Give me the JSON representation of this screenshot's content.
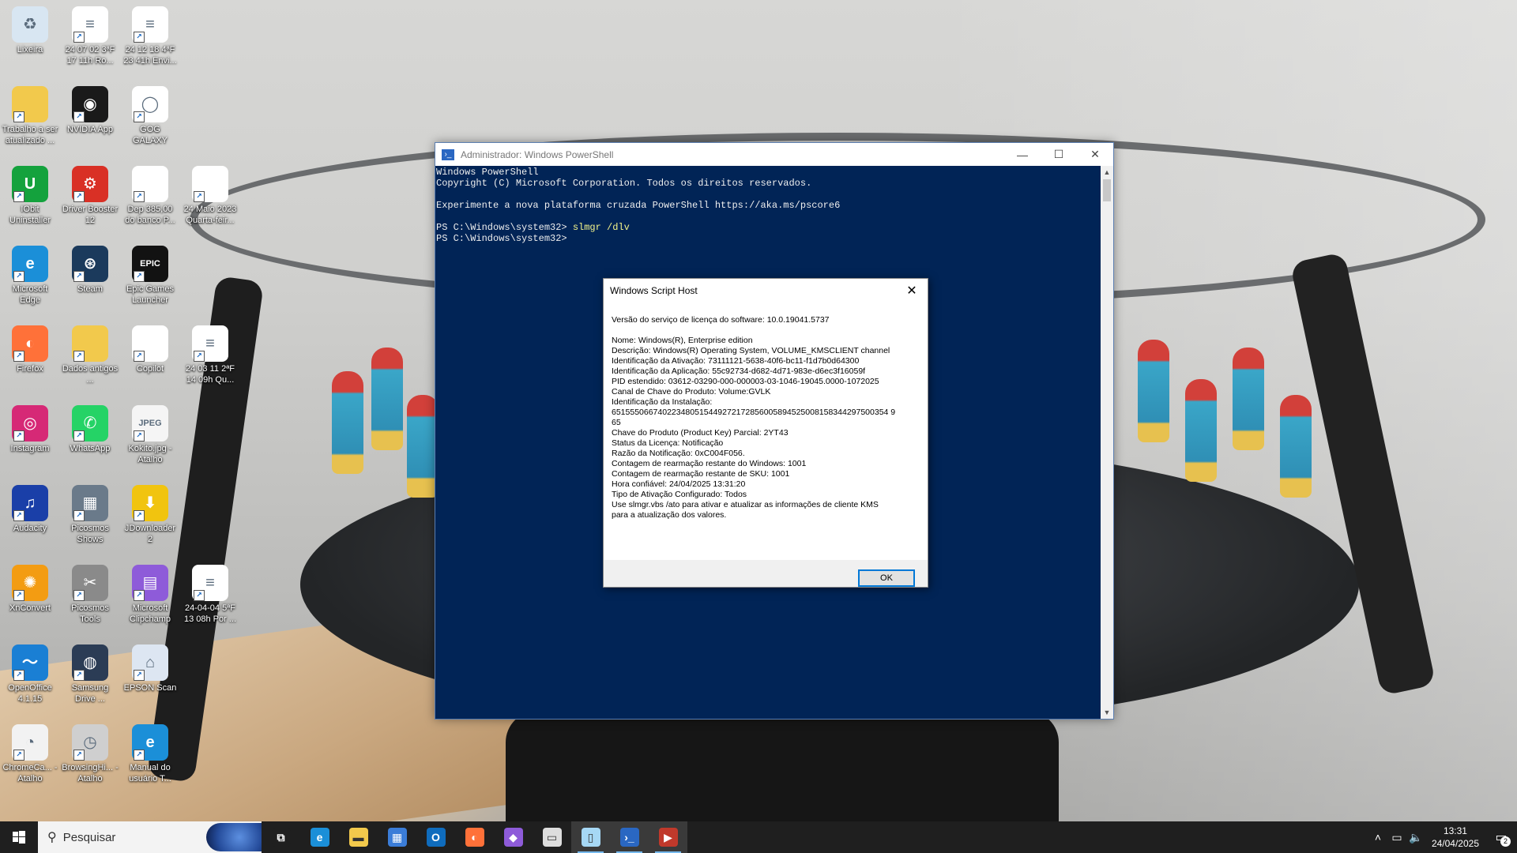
{
  "desktop": {
    "icons": [
      {
        "label": "Lixeira",
        "icon": "recycle-bin-icon",
        "color": "#d8e6f2",
        "glyph": "♻"
      },
      {
        "label": "24 07 02 3ªF 17 11h Ro...",
        "icon": "document-icon",
        "color": "#ffffff",
        "glyph": "≡"
      },
      {
        "label": "24 12 18 4ªF 23 41h Envi...",
        "icon": "document-icon",
        "color": "#ffffff",
        "glyph": "≡"
      },
      {
        "label": "Trabalho a ser atualizado ...",
        "icon": "folder-icon",
        "color": "#f2c94c",
        "glyph": ""
      },
      {
        "label": "NVIDIA App",
        "icon": "nvidia-icon",
        "color": "#1a1a1a",
        "glyph": "◉"
      },
      {
        "label": "GOG GALAXY",
        "icon": "gog-galaxy-icon",
        "color": "#ffffff",
        "glyph": "◯"
      },
      {
        "label": "IObit Uninstaller",
        "icon": "iobit-uninstaller-icon",
        "color": "#14a23d",
        "glyph": "U"
      },
      {
        "label": "Driver Booster 12",
        "icon": "driver-booster-icon",
        "color": "#d93025",
        "glyph": "⚙"
      },
      {
        "label": "Dep 385,00 do banco P...",
        "icon": "document-icon",
        "color": "#ffffff",
        "glyph": ""
      },
      {
        "label": "24 Maio 2023 Quarta-feir...",
        "icon": "document-icon",
        "color": "#ffffff",
        "glyph": ""
      },
      {
        "label": "Microsoft Edge",
        "icon": "edge-icon",
        "color": "#1b8fd8",
        "glyph": "e"
      },
      {
        "label": "Steam",
        "icon": "steam-icon",
        "color": "#1b3a5c",
        "glyph": "⊛"
      },
      {
        "label": "Epic Games Launcher",
        "icon": "epic-games-icon",
        "color": "#121212",
        "glyph": "EPIC"
      },
      {
        "label": "Firefox",
        "icon": "firefox-icon",
        "color": "#ff7139",
        "glyph": "◐"
      },
      {
        "label": "Dados antigos ...",
        "icon": "folder-icon",
        "color": "#f2c94c",
        "glyph": ""
      },
      {
        "label": "Copilot",
        "icon": "document-icon",
        "color": "#ffffff",
        "glyph": ""
      },
      {
        "label": "24 03 11 2ªF 14 09h Qu...",
        "icon": "document-icon",
        "color": "#ffffff",
        "glyph": "≡"
      },
      {
        "label": "Instagram",
        "icon": "instagram-icon",
        "color": "#d62976",
        "glyph": "◎"
      },
      {
        "label": "WhatsApp",
        "icon": "whatsapp-icon",
        "color": "#25d366",
        "glyph": "✆"
      },
      {
        "label": "Kokito.jpg - Atalho",
        "icon": "image-file-icon",
        "color": "#f5f5f5",
        "glyph": "JPEG"
      },
      {
        "label": "Audacity",
        "icon": "audacity-icon",
        "color": "#1a3fa8",
        "glyph": "♫"
      },
      {
        "label": "Picosmos Shows",
        "icon": "picosmos-shows-icon",
        "color": "#6a7a8a",
        "glyph": "▦"
      },
      {
        "label": "JDownloader 2",
        "icon": "jdownloader-icon",
        "color": "#f1c40f",
        "glyph": "⬇"
      },
      {
        "label": "XnConvert",
        "icon": "xnconvert-icon",
        "color": "#f39c12",
        "glyph": "✺"
      },
      {
        "label": "Picosmos Tools",
        "icon": "picosmos-tools-icon",
        "color": "#8a8a8a",
        "glyph": "✂"
      },
      {
        "label": "Microsoft Clipchamp",
        "icon": "clipchamp-icon",
        "color": "#8e5bd9",
        "glyph": "▤"
      },
      {
        "label": "24-04-04 5ªF 13 08h Por ...",
        "icon": "document-icon",
        "color": "#ffffff",
        "glyph": "≡"
      },
      {
        "label": "OpenOffice 4.1.15",
        "icon": "openoffice-icon",
        "color": "#1a7fd4",
        "glyph": "〜"
      },
      {
        "label": "Samsung Drive ...",
        "icon": "samsung-drive-icon",
        "color": "#2b3c55",
        "glyph": "◍"
      },
      {
        "label": "EPSON Scan",
        "icon": "epson-scan-icon",
        "color": "#dde6f2",
        "glyph": "⌂"
      },
      {
        "label": "ChromeCa... - Atalho",
        "icon": "chrome-cache-icon",
        "color": "#f2f2f2",
        "glyph": "◔"
      },
      {
        "label": "BrowsingHi... - Atalho",
        "icon": "browsing-history-icon",
        "color": "#cfcfcf",
        "glyph": "◷"
      },
      {
        "label": "Manual do usuário T...",
        "icon": "edge-icon",
        "color": "#1b8fd8",
        "glyph": "e"
      }
    ]
  },
  "powershell": {
    "title": "Administrador: Windows PowerShell",
    "line1": "Windows PowerShell",
    "line2": "Copyright (C) Microsoft Corporation. Todos os direitos reservados.",
    "line3": "Experimente a nova plataforma cruzada PowerShell https://aka.ms/pscore6",
    "prompt": "PS C:\\Windows\\system32> ",
    "command": "slmgr /dlv",
    "prompt2": "PS C:\\Windows\\system32> ",
    "background": "#012456"
  },
  "wsh": {
    "title": "Windows Script Host",
    "version": "Versão do serviço de licença do software: 10.0.19041.5737",
    "lines": [
      "Nome: Windows(R), Enterprise edition",
      "Descrição: Windows(R) Operating System, VOLUME_KMSCLIENT channel",
      "Identificação da Ativação: 73111121-5638-40f6-bc11-f1d7b0d64300",
      "Identificação da Aplicação: 55c92734-d682-4d71-983e-d6ec3f16059f",
      "PID estendido: 03612-03290-000-000003-03-1046-19045.0000-1072025",
      "Canal de Chave do Produto: Volume:GVLK",
      "Identificação da Instalação:",
      "651555066740223480515449272172856005894525008158344297500354 9",
      "65",
      "Chave do Produto (Product Key) Parcial: 2YT43",
      "Status da Licença: Notificação",
      "Razão da Notificação: 0xC004F056.",
      "Contagem de rearmação restante do Windows: 1001",
      "Contagem de rearmação restante de SKU: 1001",
      "Hora confiável: 24/04/2025 13:31:20",
      "Tipo de Ativação Configurado: Todos",
      "Use slmgr.vbs /ato para ativar e atualizar as informações de cliente KMS",
      "para a atualização dos valores."
    ],
    "ok_label": "OK"
  },
  "taskbar": {
    "search_placeholder": "Pesquisar",
    "apps": [
      {
        "icon": "task-view-icon",
        "glyph": "⧉",
        "color": "#1f1f1f"
      },
      {
        "icon": "edge-icon",
        "glyph": "e",
        "color": "#1b8fd8"
      },
      {
        "icon": "file-explorer-icon",
        "glyph": "▬",
        "color": "#f2c94c"
      },
      {
        "icon": "microsoft-store-icon",
        "glyph": "▦",
        "color": "#3b7dd8"
      },
      {
        "icon": "outlook-icon",
        "glyph": "O",
        "color": "#0f6cbd"
      },
      {
        "icon": "firefox-icon",
        "glyph": "◐",
        "color": "#ff7139"
      },
      {
        "icon": "copilot-icon",
        "glyph": "◆",
        "color": "#8e5bd9"
      },
      {
        "icon": "book-icon",
        "glyph": "▭",
        "color": "#dddddd"
      },
      {
        "icon": "notepad-icon",
        "glyph": "▯",
        "color": "#a6d8f5"
      },
      {
        "icon": "powershell-icon",
        "glyph": "›_",
        "color": "#2a67c2"
      },
      {
        "icon": "media-app-icon",
        "glyph": "▶",
        "color": "#c0392b"
      }
    ],
    "time": "13:31",
    "date": "24/04/2025",
    "notifications": "2"
  }
}
